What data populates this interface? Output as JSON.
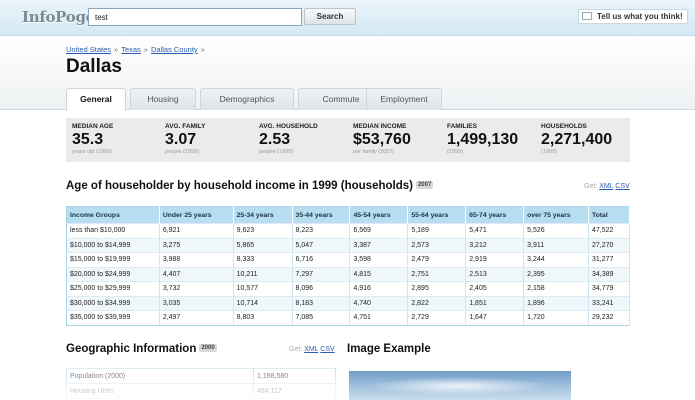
{
  "app": {
    "logo": "InfoPogo",
    "search": {
      "value": "test",
      "button_label": "Search"
    },
    "feedback_label": "Tell us what you think!"
  },
  "breadcrumb": [
    "United States",
    "Texas",
    "Dallas County"
  ],
  "breadcrumb_sep": "»",
  "page_title": "Dallas",
  "tabs": [
    "General",
    "Housing",
    "Demographics",
    "Commute",
    "Employment"
  ],
  "active_tab": "General",
  "stats": [
    {
      "label": "MEDIAN AGE",
      "value": "35.3",
      "sub": "years old (1999)"
    },
    {
      "label": "AVG. FAMILY",
      "value": "3.07",
      "sub": "people (1999)"
    },
    {
      "label": "AVG. HOUSEHOLD",
      "value": "2.53",
      "sub": "people (1999)"
    },
    {
      "label": "MEDIAN INCOME",
      "value": "$53,760",
      "sub": "per family (2007)"
    },
    {
      "label": "FAMILIES",
      "value": "1,499,130",
      "sub": "(1999)"
    },
    {
      "label": "HOUSEHOLDS",
      "value": "2,271,400",
      "sub": "(1999)"
    }
  ],
  "income_section": {
    "title": "Age of householder by household income in 1999 (households)",
    "year": "2007",
    "get": {
      "label": "Get:",
      "xml": "XML",
      "csv": "CSV"
    },
    "columns": [
      "Income Groups",
      "Under 25 years",
      "25-34 years",
      "35-44 years",
      "45-54 years",
      "55-64 years",
      "65-74 years",
      "over 75 years",
      "Total"
    ],
    "rows": [
      [
        "less than $10,000",
        "6,921",
        "9,623",
        "8,223",
        "6,569",
        "5,189",
        "5,471",
        "5,526",
        "47,522"
      ],
      [
        "$10,000 to $14,999",
        "3,275",
        "5,865",
        "5,047",
        "3,387",
        "2,573",
        "3,212",
        "3,911",
        "27,270"
      ],
      [
        "$15,000 to $19,999",
        "3,988",
        "8,333",
        "6,716",
        "3,598",
        "2,479",
        "2,919",
        "3,244",
        "31,277"
      ],
      [
        "$20,000 to $24,999",
        "4,407",
        "10,211",
        "7,297",
        "4,815",
        "2,751",
        "2,513",
        "2,395",
        "34,389"
      ],
      [
        "$25,000 to $29,999",
        "3,732",
        "10,577",
        "8,096",
        "4,916",
        "2,895",
        "2,405",
        "2,158",
        "34,779"
      ],
      [
        "$30,000 to $34,999",
        "3,035",
        "10,714",
        "8,183",
        "4,740",
        "2,822",
        "1,851",
        "1,896",
        "33,241"
      ],
      [
        "$35,000 to $39,999",
        "2,497",
        "8,803",
        "7,085",
        "4,751",
        "2,729",
        "1,647",
        "1,720",
        "29,232"
      ]
    ]
  },
  "geo_section": {
    "title": "Geographic Information",
    "year": "2000",
    "get": {
      "label": "Get:",
      "xml": "XML",
      "csv": "CSV"
    },
    "rows": [
      [
        "Population (2000)",
        "1,188,580"
      ],
      [
        "Housing Units",
        "484,117"
      ]
    ]
  },
  "image_section": {
    "title": "Image Example"
  }
}
